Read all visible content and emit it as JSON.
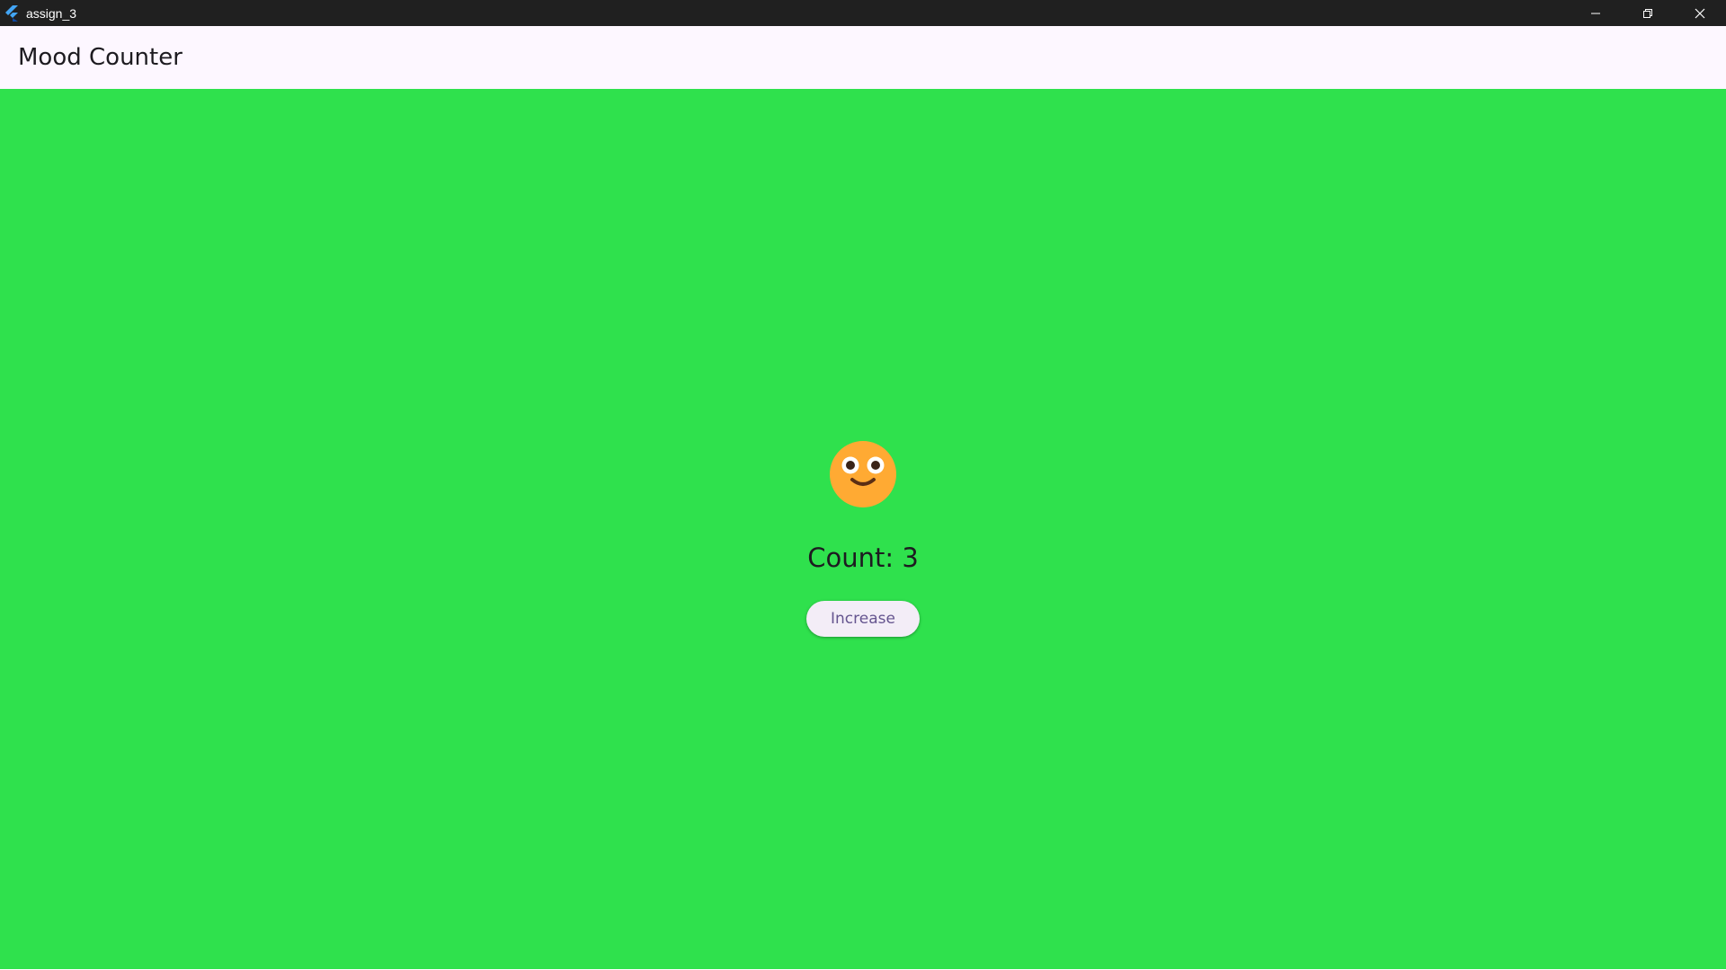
{
  "window": {
    "title": "assign_3",
    "icon": "flutter-logo-icon",
    "controls": [
      "minimize-icon",
      "restore-icon",
      "close-icon"
    ]
  },
  "appbar": {
    "title": "Mood Counter"
  },
  "main": {
    "emoji_icon": "smiling-face-icon",
    "count_text": "Count: 3",
    "increase_label": "Increase"
  },
  "colors": {
    "background": "#2fe14d",
    "appbar": "#fdf7ff",
    "button_bg": "#f3edf7",
    "button_text": "#65558f",
    "emoji_face": "#ffaa33"
  }
}
